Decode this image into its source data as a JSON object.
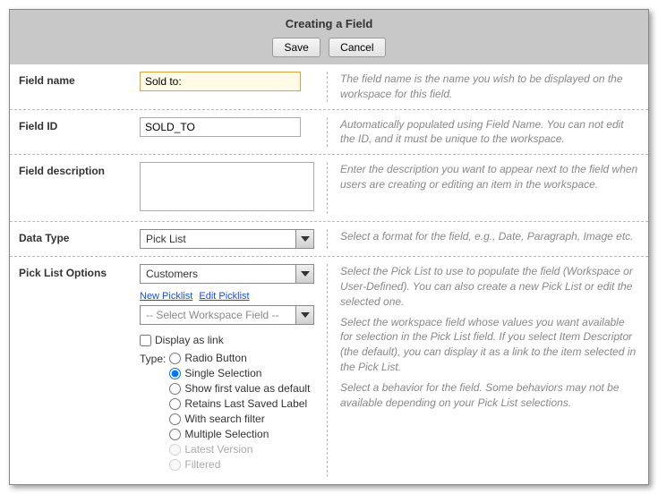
{
  "header": {
    "title": "Creating a Field"
  },
  "toolbar": {
    "save": "Save",
    "cancel": "Cancel"
  },
  "fields": {
    "fieldName": {
      "label": "Field name",
      "value": "Sold to:",
      "help": "The field name is the name you wish to be displayed on the workspace for this field."
    },
    "fieldId": {
      "label": "Field ID",
      "value": "SOLD_TO",
      "help": "Automatically populated using Field Name. You can not edit the ID, and it must be unique to the workspace."
    },
    "fieldDesc": {
      "label": "Field description",
      "value": "",
      "help": "Enter the description you want to appear next to the field when users are creating or editing an item in the workspace."
    },
    "dataType": {
      "label": "Data Type",
      "value": "Pick List",
      "help": "Select a format for the field, e.g., Date, Paragraph, Image etc."
    },
    "pickList": {
      "label": "Pick List Options",
      "selected": "Customers",
      "newLink": "New Picklist",
      "editLink": "Edit Picklist",
      "wsFieldPlaceholder": "-- Select Workspace Field --",
      "displayAsLink": "Display as link",
      "typeLabel": "Type:",
      "radios": {
        "radioButton": "Radio Button",
        "singleSelection": "Single Selection",
        "showFirst": "Show first value as default",
        "retains": "Retains Last Saved Label",
        "searchFilter": "With search filter",
        "multiple": "Multiple Selection",
        "latest": "Latest Version",
        "filtered": "Filtered"
      },
      "help1": "Select the Pick List to use to populate the field (Workspace or User-Defined). You can also create a new Pick List or edit the selected one.",
      "help2": "Select the workspace field whose values you want available for selection in the Pick List field. If you select Item Descriptor (the default), you can display it as a link to the item selected in the Pick List.",
      "help3": "Select a behavior for the field. Some behaviors may not be available depending on your Pick List selections."
    }
  }
}
